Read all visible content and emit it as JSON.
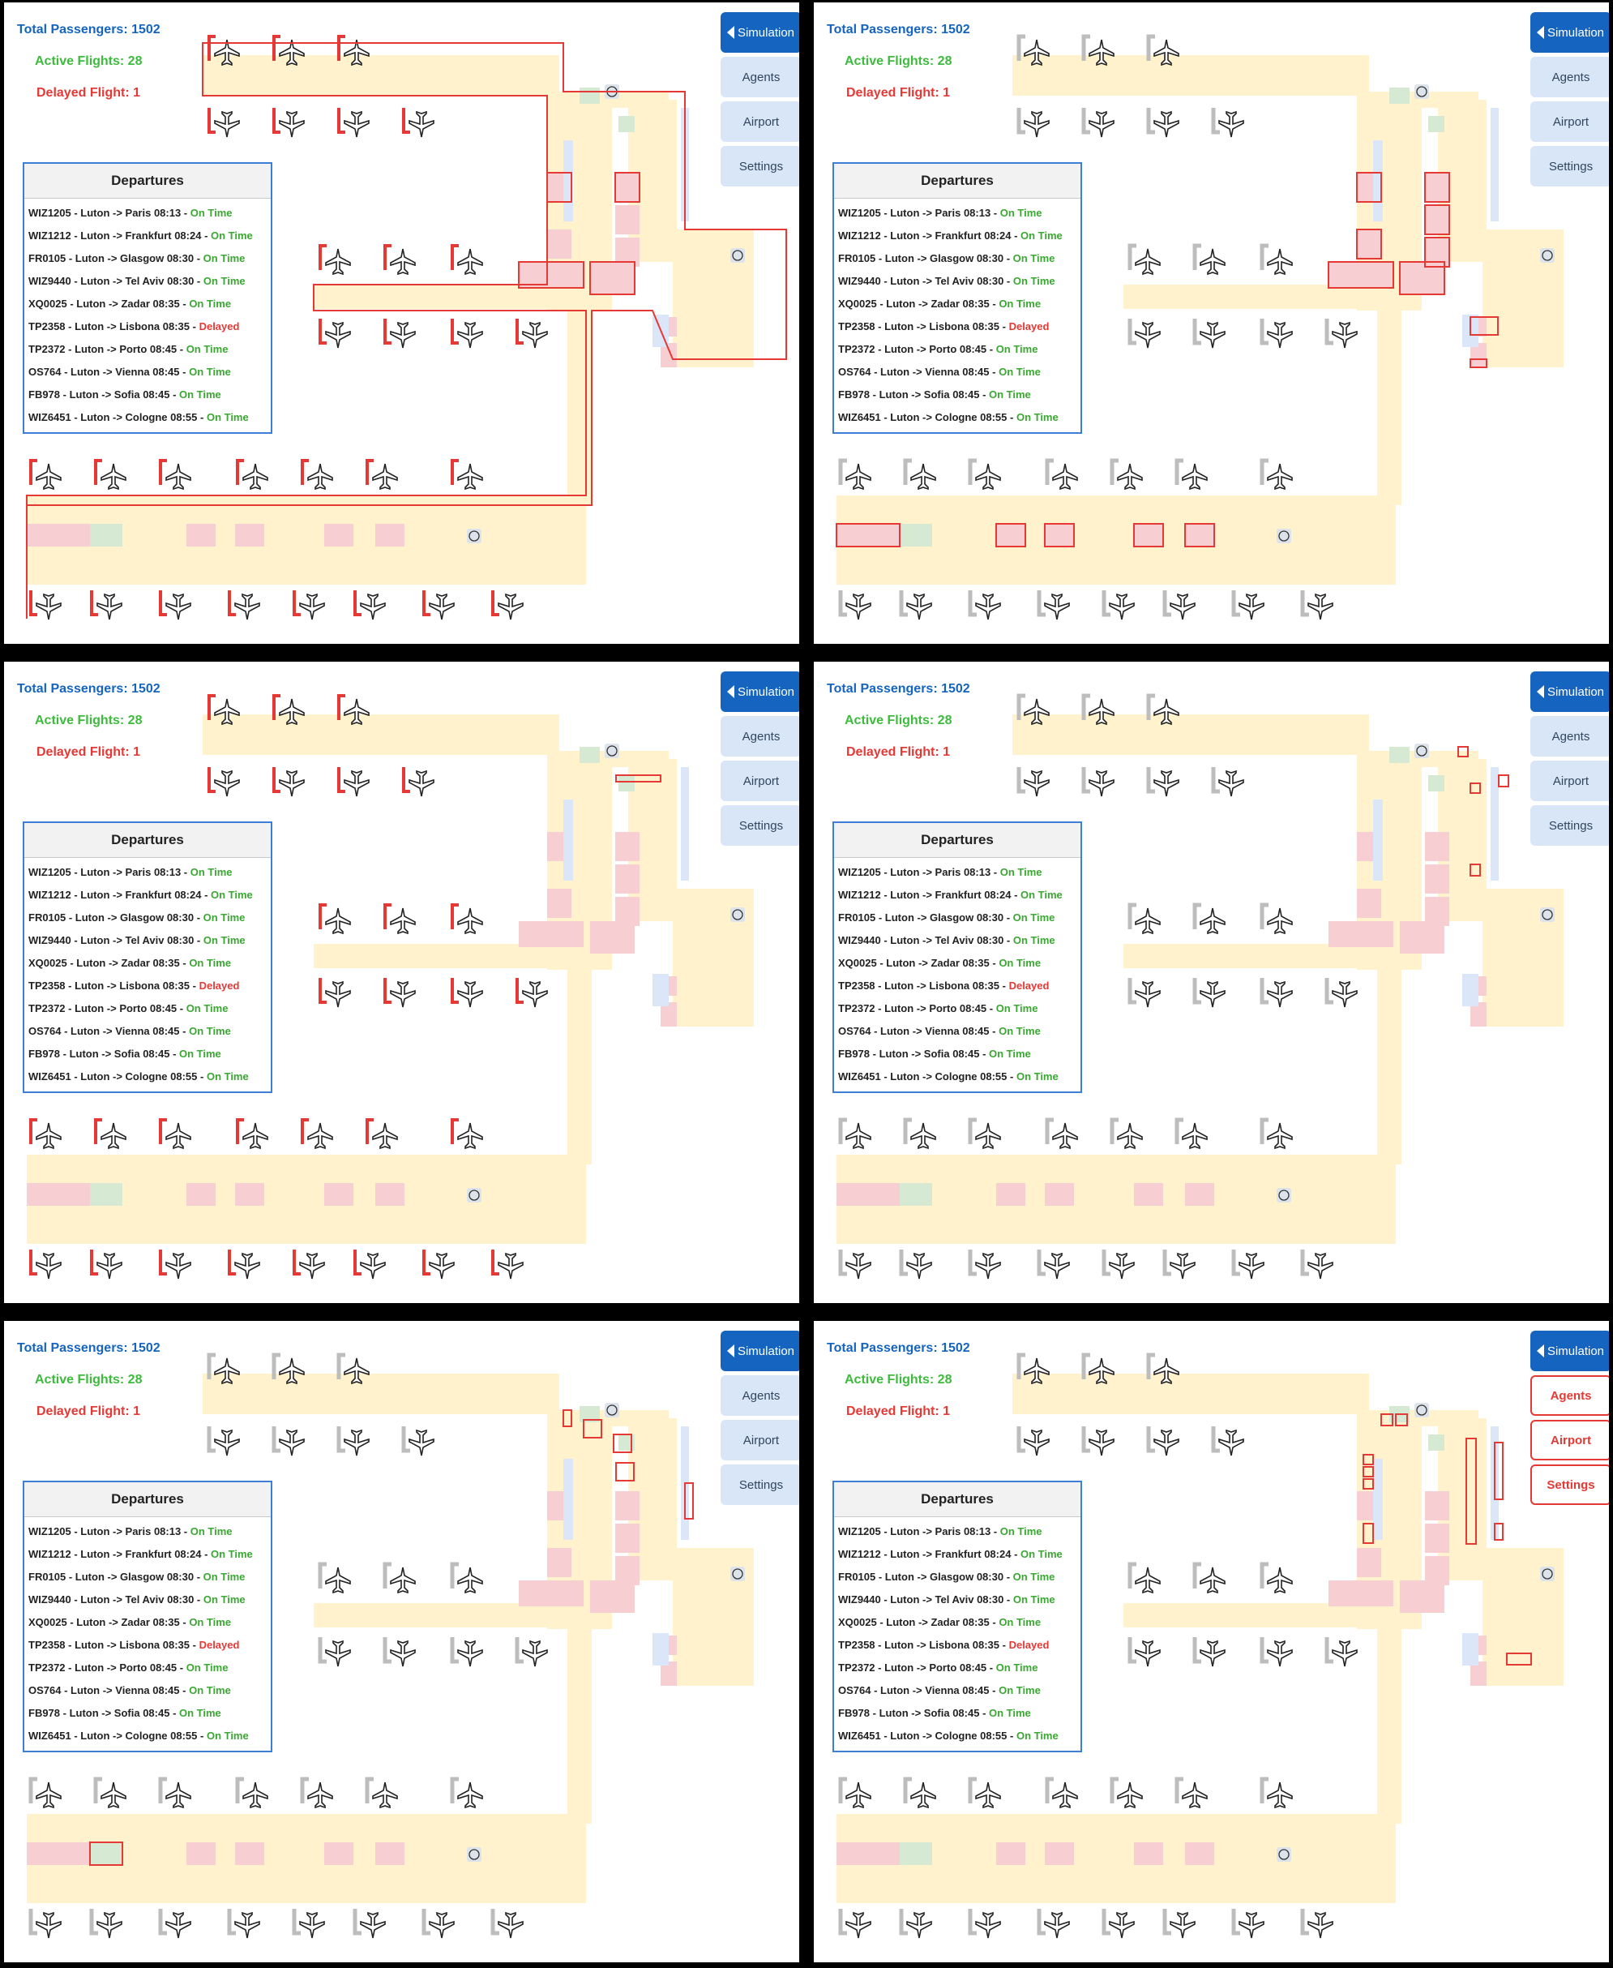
{
  "stats": {
    "total_passengers": "Total Passengers: 1502",
    "active_flights": "Active Flights: 28",
    "delayed_flight": "Delayed Flight: 1"
  },
  "departures": {
    "title": "Departures",
    "rows": [
      {
        "text": "WIZ1205 - Luton -> Paris 08:13 - ",
        "status": "On Time"
      },
      {
        "text": "WIZ1212 - Luton -> Frankfurt 08:24 - ",
        "status": "On Time"
      },
      {
        "text": "FR0105 - Luton -> Glasgow 08:30 - ",
        "status": "On Time"
      },
      {
        "text": "WIZ9440 - Luton -> Tel Aviv 08:30 - ",
        "status": "On Time"
      },
      {
        "text": "XQ0025 - Luton -> Zadar 08:35 - ",
        "status": "On Time"
      },
      {
        "text": "TP2358 - Luton -> Lisbona 08:35 - ",
        "status": "Delayed"
      },
      {
        "text": "TP2372 - Luton -> Porto 08:45 - ",
        "status": "On Time"
      },
      {
        "text": "OS764 - Luton -> Vienna 08:45 - ",
        "status": "On Time"
      },
      {
        "text": "FB978 - Luton -> Sofia 08:45 - ",
        "status": "On Time"
      },
      {
        "text": "WIZ6451 - Luton -> Cologne 08:55 - ",
        "status": "On Time"
      }
    ]
  },
  "menu": {
    "simulation": "Simulation",
    "agents": "Agents",
    "airport": "Airport",
    "settings": "Settings"
  },
  "colors": {
    "total": "#1565c0",
    "active": "#3dbb3d",
    "delayed": "#e53935",
    "accent": "#1565c0",
    "highlight": "#e53935"
  },
  "icons": [
    "airplane-icon",
    "info-icon",
    "chevron-left-icon"
  ],
  "panels": [
    {
      "highlight": "gates"
    },
    {
      "highlight": "shops"
    },
    {
      "highlight": "gate-walls"
    },
    {
      "highlight": "seats"
    },
    {
      "highlight": "misc"
    },
    {
      "highlight": "menu"
    }
  ]
}
